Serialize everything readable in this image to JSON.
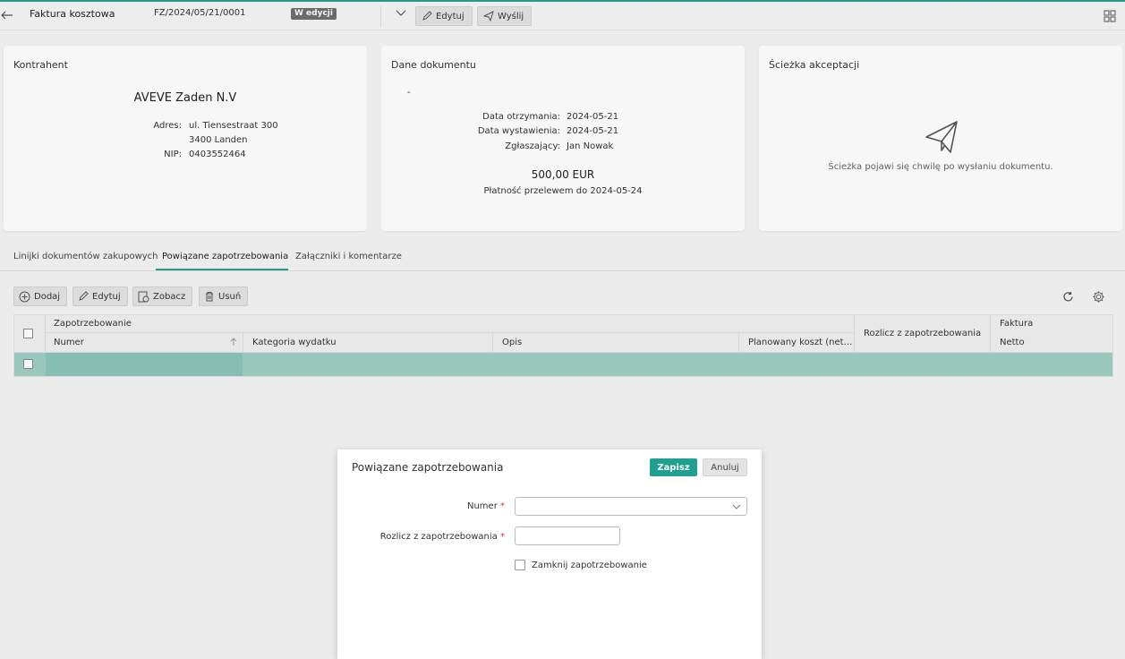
{
  "header": {
    "doc_type": "Faktura kosztowa",
    "doc_number": "FZ/2024/05/21/0001",
    "status_badge": "W edycji",
    "edit_label": "Edytuj",
    "send_label": "Wyślij"
  },
  "contractor": {
    "title": "Kontrahent",
    "name": "AVEVE Zaden N.V",
    "address_label": "Adres:",
    "address_line1": "ul. Tiensestraat 300",
    "address_line2": "3400 Landen",
    "nip_label": "NIP:",
    "nip": "0403552464"
  },
  "document": {
    "title": "Dane dokumentu",
    "dash": "-",
    "received_label": "Data otrzymania:",
    "received": "2024-05-21",
    "issued_label": "Data wystawienia:",
    "issued": "2024-05-21",
    "reporter_label": "Zgłaszający:",
    "reporter": "Jan Nowak",
    "amount": "500,00 EUR",
    "payment": "Płatność przelewem do 2024-05-24"
  },
  "path": {
    "title": "Ścieżka akceptacji",
    "message": "Ścieżka pojawi się chwilę po wysłaniu dokumentu."
  },
  "tabs": [
    {
      "label": "Linijki dokumentów zakupowych"
    },
    {
      "label": "Powiązane zapotrzebowania"
    },
    {
      "label": "Załączniki i komentarze"
    }
  ],
  "actions": {
    "add": "Dodaj",
    "edit": "Edytuj",
    "view": "Zobacz",
    "delete": "Usuń"
  },
  "table": {
    "group_header": "Zapotrzebowanie",
    "columns": {
      "number": "Numer",
      "category": "Kategoria wydatku",
      "description": "Opis",
      "planned_cost": "Planowany koszt (net…",
      "settle": "Rozlicz z zapotrzebowania",
      "invoice": "Faktura",
      "net": "Netto"
    }
  },
  "modal": {
    "title": "Powiązane zapotrzebowania",
    "save": "Zapisz",
    "cancel": "Anuluj",
    "number_label": "Numer",
    "settle_label": "Rozlicz z zapotrzebowania",
    "required_mark": "*",
    "close_label": "Zamknij zapotrzebowanie",
    "number_value": "",
    "settle_value": ""
  },
  "colors": {
    "accent": "#1fa090",
    "selected_row": "#9fcfc4"
  }
}
